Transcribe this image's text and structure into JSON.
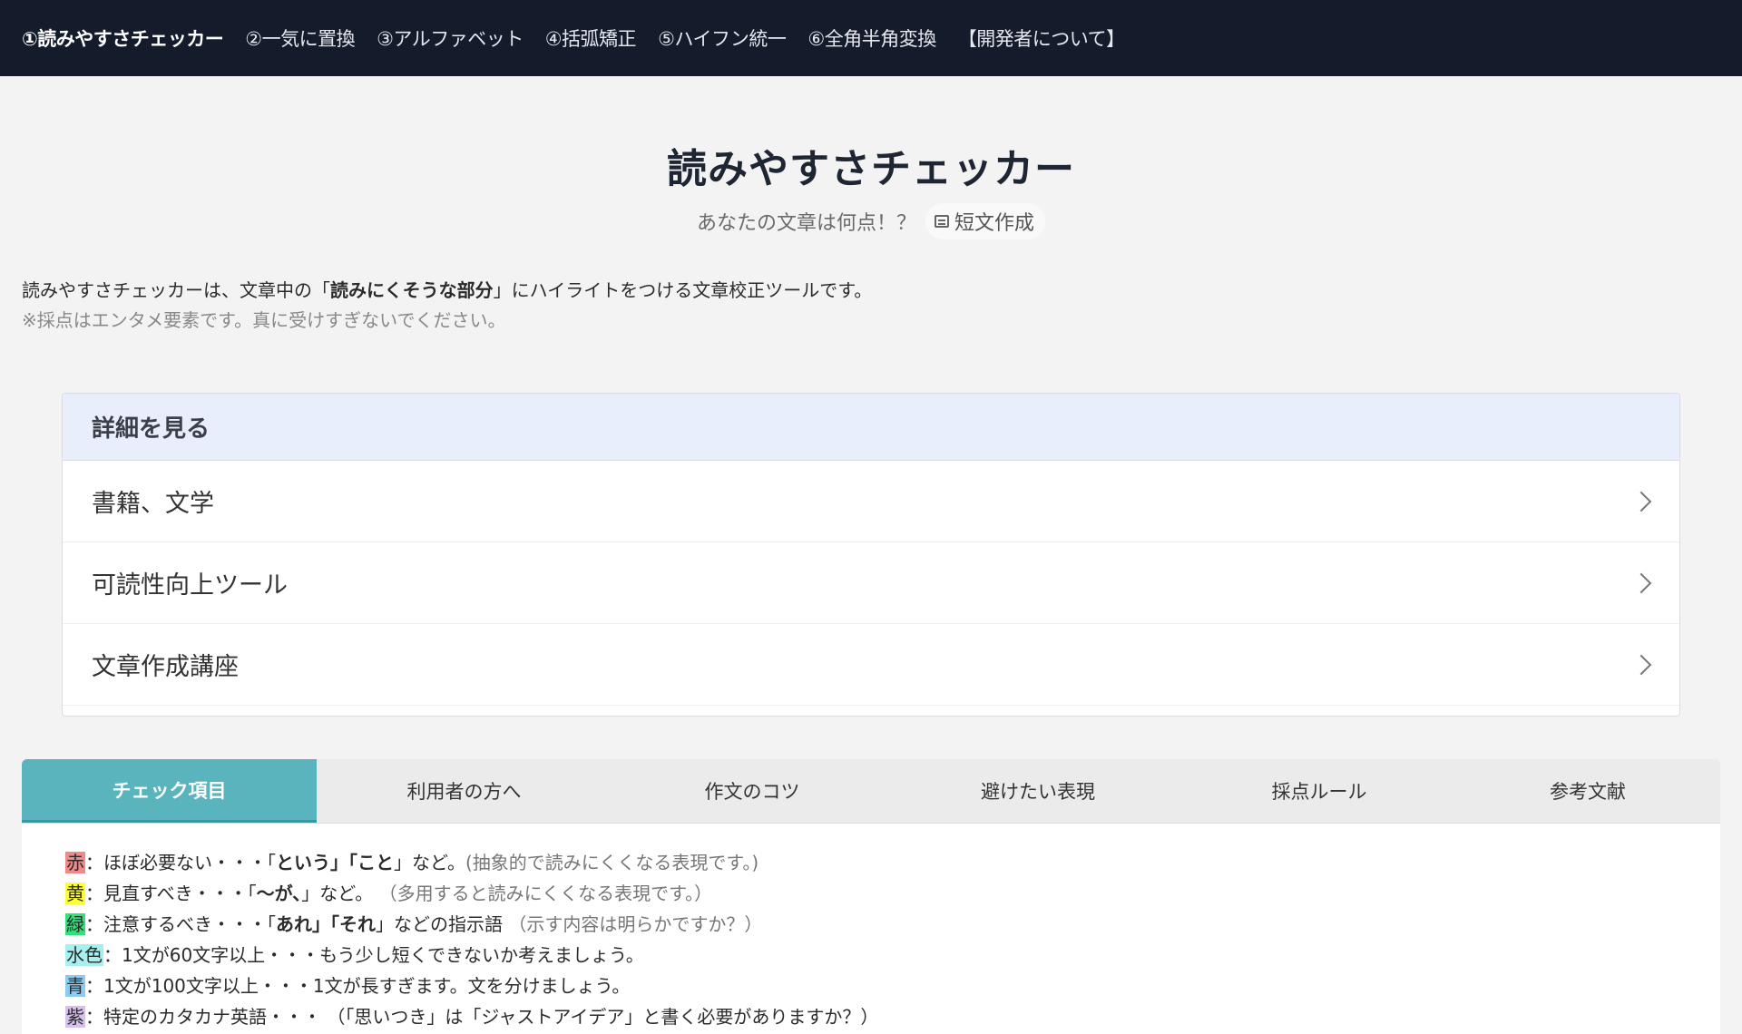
{
  "nav": {
    "items": [
      {
        "label": "①読みやすさチェッカー",
        "active": true
      },
      {
        "label": "②一気に置換"
      },
      {
        "label": "③アルファベット"
      },
      {
        "label": "④括弧矯正"
      },
      {
        "label": "⑤ハイフン統一"
      },
      {
        "label": "⑥全角半角変換"
      },
      {
        "label": "【開発者について】"
      }
    ]
  },
  "hero": {
    "title": "読みやすさチェッカー",
    "subtitle": "あなたの文章は何点！？",
    "pill_label": "短文作成"
  },
  "intro": {
    "line_prefix": "読みやすさチェッカーは、文章中の「",
    "line_bold": "読みにくそうな部分",
    "line_suffix": "」にハイライトをつける文章校正ツールです。",
    "note": "※採点はエンタメ要素です。真に受けすぎないでください。"
  },
  "details": {
    "header": "詳細を見る",
    "rows": [
      "書籍、文学",
      "可読性向上ツール",
      "文章作成講座"
    ]
  },
  "tabs": {
    "items": [
      "チェック項目",
      "利用者の方へ",
      "作文のコツ",
      "避けたい表現",
      "採点ルール",
      "参考文献"
    ],
    "active_index": 0,
    "active_color": "#5ab4bd"
  },
  "legend": [
    {
      "swatch": "赤",
      "color": "#f08a8a",
      "pre": "：ほぼ必要ない・・・「",
      "bold": "という」「こと",
      "post": "」など。",
      "hint": "(抽象的で読みにくくなる表現です。)"
    },
    {
      "swatch": "黄",
      "color": "#ffff33",
      "pre": "：見直すべき・・・「",
      "bold": "〜が、",
      "post": "」など。",
      "hint": "（多用すると読みにくくなる表現です。）"
    },
    {
      "swatch": "緑",
      "color": "#33e07a",
      "pre": "：注意するべき・・・「",
      "bold": "あれ」「それ",
      "post": "」などの指示語",
      "hint": "（示す内容は明らかですか？）"
    },
    {
      "swatch": "水色",
      "color": "#a8f0f0",
      "pre": "：1文が60文字以上・・・もう少し短くできないか考えましょう。",
      "bold": "",
      "post": "",
      "hint": ""
    },
    {
      "swatch": "青",
      "color": "#8ecbf0",
      "pre": "：1文が100文字以上・・・1文が長すぎます。文を分けましょう。",
      "bold": "",
      "post": "",
      "hint": ""
    },
    {
      "swatch": "紫",
      "color": "#d8c0f0",
      "pre": "：特定のカタカナ英語・・・ （「思いつき」は「ジャストアイデア」と書く必要がありますか？）",
      "bold": "",
      "post": "",
      "hint": ""
    }
  ]
}
